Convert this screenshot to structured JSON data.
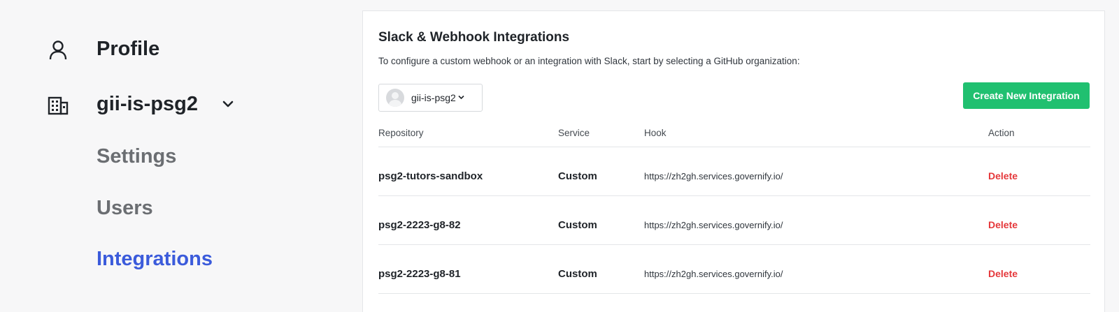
{
  "sidebar": {
    "profile_label": "Profile",
    "org_label": "gii-is-psg2",
    "sub_items": [
      {
        "label": "Settings"
      },
      {
        "label": "Users"
      },
      {
        "label": "Integrations"
      }
    ],
    "active_item": "Integrations",
    "accent_color": "#3b5bdb"
  },
  "panel": {
    "title": "Slack & Webhook Integrations",
    "description": "To configure a custom webhook or an integration with Slack, start by selecting a GitHub organization:",
    "org_select": {
      "value": "gii-is-psg2"
    },
    "create_button_label": "Create New Integration",
    "create_button_color": "#20c070",
    "table": {
      "columns": [
        "Repository",
        "Service",
        "Hook",
        "Action"
      ],
      "rows": [
        {
          "repository": "psg2-tutors-sandbox",
          "service": "Custom",
          "hook": "https://zh2gh.services.governify.io/",
          "action": "Delete"
        },
        {
          "repository": "psg2-2223-g8-82",
          "service": "Custom",
          "hook": "https://zh2gh.services.governify.io/",
          "action": "Delete"
        },
        {
          "repository": "psg2-2223-g8-81",
          "service": "Custom",
          "hook": "https://zh2gh.services.governify.io/",
          "action": "Delete"
        }
      ]
    },
    "delete_color": "#e5383b"
  },
  "icons": [
    "user-icon",
    "building-icon",
    "chevron-down-icon",
    "org-avatar-icon"
  ]
}
